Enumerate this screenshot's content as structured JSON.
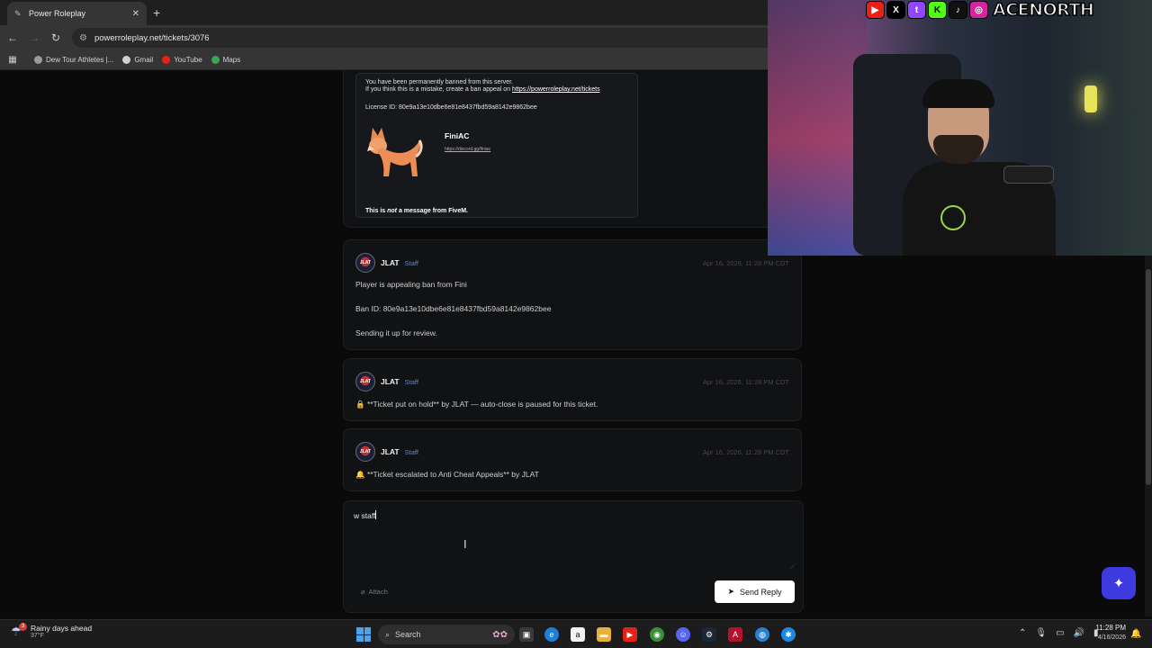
{
  "browser": {
    "tab_title": "Power Roleplay",
    "url": "powerroleplay.net/tickets/3076",
    "bookmarks": [
      {
        "label": "Dew Tour Athletes |...",
        "color": "#9a9a9a"
      },
      {
        "label": "Gmail",
        "color": "#d0d0d0"
      },
      {
        "label": "YouTube",
        "color": "#e62117"
      },
      {
        "label": "Maps",
        "color": "#34a853"
      }
    ]
  },
  "ban_embed": {
    "line1": "You have been permanently banned from this server.",
    "line2_prefix": "If you think this is a mistake, create a ban appeal on ",
    "line2_link": "https://powerroleplay.net/tickets",
    "license": "License ID: 80e9a13e10dbe6e81e8437fbd59a8142e9862bee",
    "brand": "FiniAC",
    "brand_link": "https://discord.gg/finiac",
    "footer_pre": "This is ",
    "footer_em": "not",
    "footer_post": " a message from FiveM."
  },
  "messages": [
    {
      "author": "JLAT",
      "role": "Staff",
      "avatar_text": "JLAT",
      "time": "Apr 16, 2026, 11:28 PM CDT",
      "lines": [
        "Player is appealing ban from Fini",
        "Ban ID: 80e9a13e10dbe6e81e8437fbd59a8142e9862bee",
        "Sending it up for review."
      ]
    },
    {
      "author": "JLAT",
      "role": "Staff",
      "avatar_text": "JLAT",
      "time": "Apr 16, 2026, 11:28 PM CDT",
      "lines": [
        "🔒 **Ticket put on hold** by JLAT — auto-close is paused for this ticket."
      ]
    },
    {
      "author": "JLAT",
      "role": "Staff",
      "avatar_text": "JLAT",
      "time": "Apr 16, 2026, 11:28 PM CDT",
      "lines": [
        "🔔 **Ticket escalated to Anti Cheat Appeals** by JLAT"
      ]
    }
  ],
  "reply": {
    "value": "w staff",
    "attach_label": "Attach",
    "send_label": "Send Reply"
  },
  "overlay": {
    "handle": "ACENORTH",
    "socials": [
      {
        "name": "youtube-icon",
        "glyph": "▶",
        "color": "#e62117"
      },
      {
        "name": "x-icon",
        "glyph": "X",
        "color": "#000000"
      },
      {
        "name": "twitch-icon",
        "glyph": "t",
        "color": "#9146ff"
      },
      {
        "name": "kick-icon",
        "glyph": "K",
        "color": "#53fc18"
      },
      {
        "name": "tiktok-icon",
        "glyph": "♪",
        "color": "#111111"
      },
      {
        "name": "instagram-icon",
        "glyph": "◎",
        "color": "#d6249f"
      }
    ]
  },
  "taskbar": {
    "weather_title": "Rainy days ahead",
    "weather_temp": "37°F",
    "weather_badge": "3",
    "search_label": "Search",
    "time": "11:28 PM",
    "date": "4/16/2026"
  }
}
